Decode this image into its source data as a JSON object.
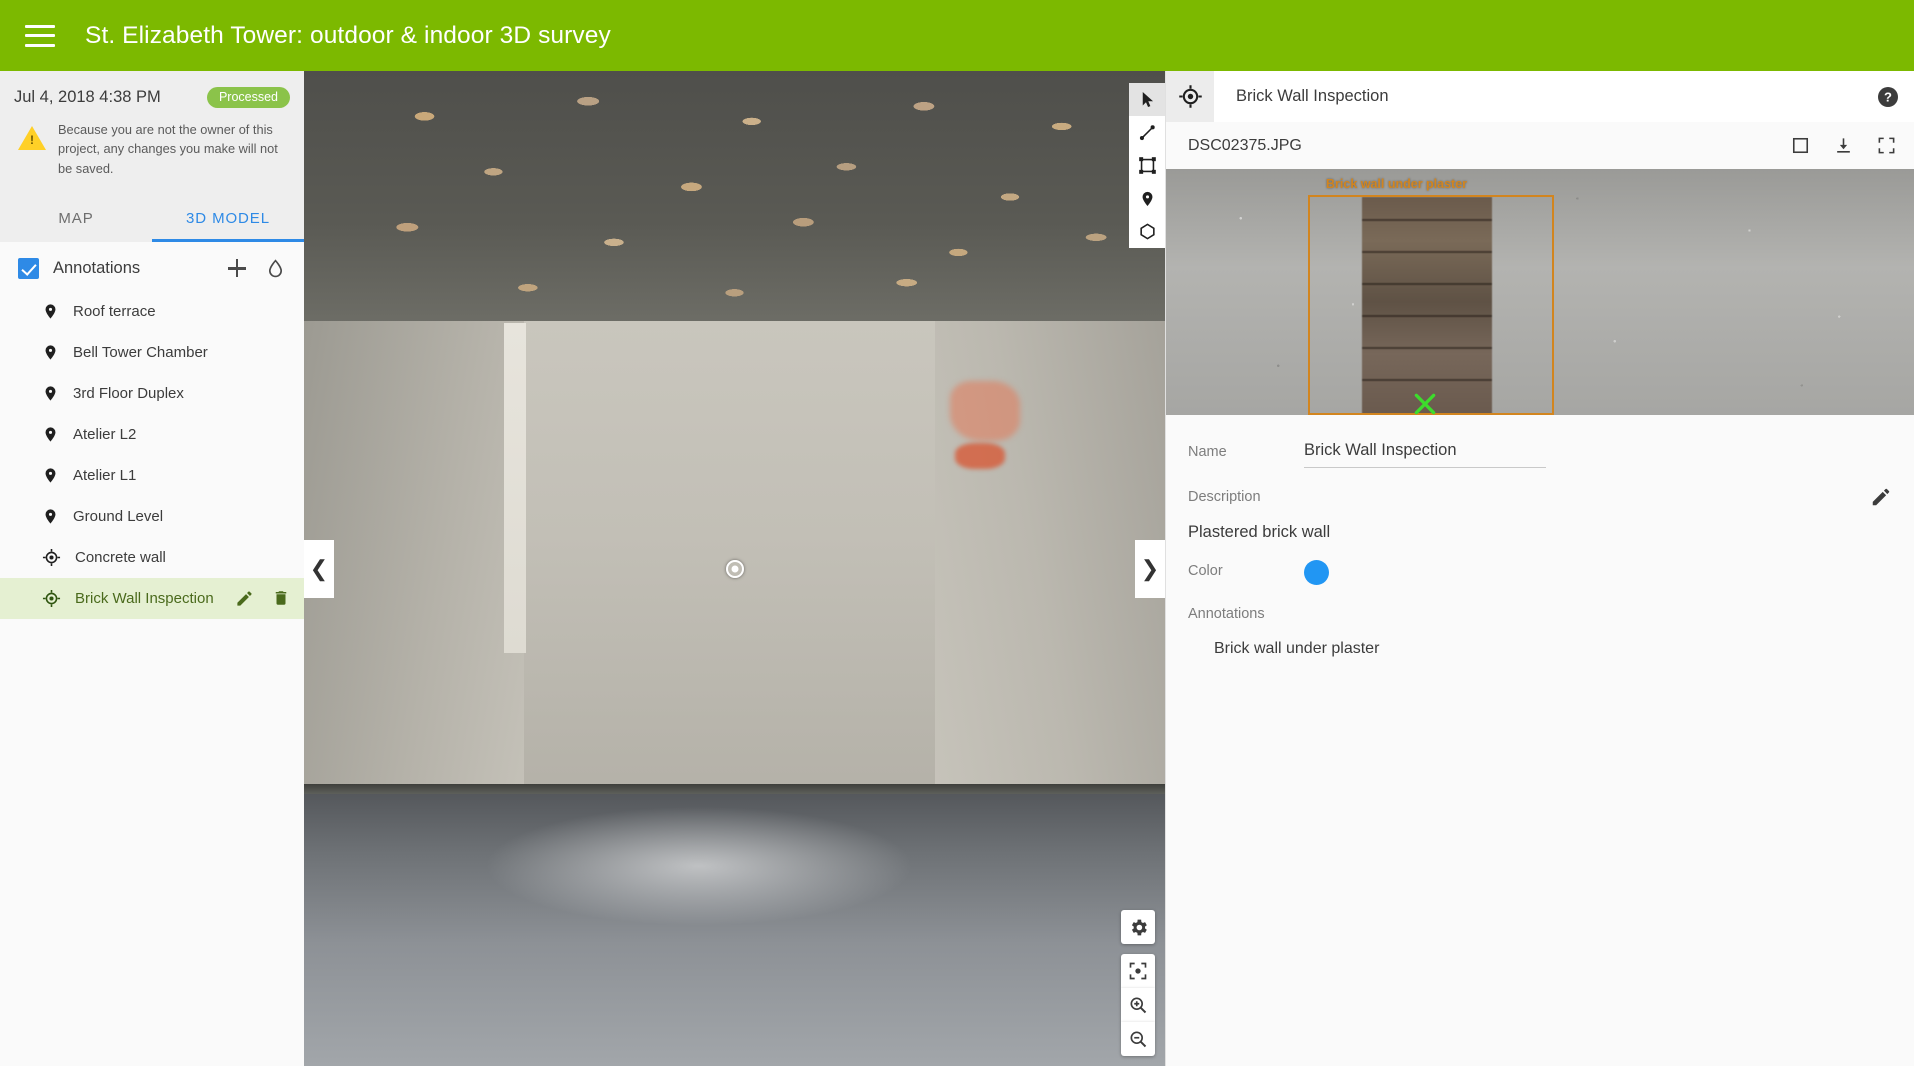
{
  "header": {
    "menu_icon": "hamburger-menu-icon",
    "title": "St. Elizabeth Tower: outdoor & indoor 3D survey",
    "background_color": "#7cb900"
  },
  "sidebar": {
    "date": "Jul 4, 2018 4:38 PM",
    "status_badge": "Processed",
    "status_color": "#8bc34a",
    "warning_icon": "warning-triangle-icon",
    "warning_text": "Because you are not the owner of this project, any changes you make will not be saved.",
    "tabs": [
      {
        "label": "MAP",
        "active": false
      },
      {
        "label": "3D MODEL",
        "active": true
      }
    ],
    "active_tab_color": "#2e8ae6",
    "annotations_group": {
      "label": "Annotations",
      "checked": true,
      "add_icon": "plus-icon",
      "layer_icon": "droplet-icon"
    },
    "items": [
      {
        "label": "Roof terrace",
        "icon": "map-pin-icon",
        "selected": false
      },
      {
        "label": "Bell Tower Chamber",
        "icon": "map-pin-icon",
        "selected": false
      },
      {
        "label": "3rd Floor Duplex",
        "icon": "map-pin-icon",
        "selected": false
      },
      {
        "label": "Atelier L2",
        "icon": "map-pin-icon",
        "selected": false
      },
      {
        "label": "Atelier L1",
        "icon": "map-pin-icon",
        "selected": false
      },
      {
        "label": "Ground Level",
        "icon": "map-pin-icon",
        "selected": false
      },
      {
        "label": "Concrete wall",
        "icon": "target-crosshair-icon",
        "selected": false
      },
      {
        "label": "Brick Wall Inspection",
        "icon": "target-crosshair-icon",
        "selected": true,
        "edit_icon": "pencil-icon",
        "delete_icon": "trash-icon"
      }
    ],
    "selected_row_color": "#e5f0d2"
  },
  "viewer": {
    "nav_prev_icon": "chevron-left-icon",
    "nav_next_icon": "chevron-right-icon",
    "reticle_icon": "center-reticle-icon",
    "tools": [
      {
        "name": "cursor-tool",
        "icon": "arrow-cursor-icon",
        "active": true
      },
      {
        "name": "distance-tool",
        "icon": "line-segment-icon",
        "active": false
      },
      {
        "name": "area-tool",
        "icon": "bounding-box-icon",
        "active": false
      },
      {
        "name": "marker-tool",
        "icon": "map-pin-icon",
        "active": false
      },
      {
        "name": "polygon-tool",
        "icon": "hexagon-icon",
        "active": false
      }
    ],
    "controls": [
      {
        "name": "settings-button",
        "icon": "gear-icon"
      },
      {
        "name": "center-view-button",
        "icon": "center-focus-icon"
      },
      {
        "name": "zoom-in-button",
        "icon": "magnifier-plus-icon"
      },
      {
        "name": "zoom-out-button",
        "icon": "magnifier-minus-icon"
      }
    ]
  },
  "right_panel": {
    "target_icon": "target-crosshair-icon",
    "title": "Brick Wall Inspection",
    "help_icon": "help-circle-icon",
    "filename": "DSC02375.JPG",
    "file_actions": [
      {
        "name": "toggle-box-button",
        "icon": "square-outline-icon"
      },
      {
        "name": "download-button",
        "icon": "download-icon"
      },
      {
        "name": "fullscreen-button",
        "icon": "fullscreen-icon"
      }
    ],
    "photo": {
      "annotation_label": "Brick wall under plaster",
      "annotation_box_color": "#d2851f",
      "marker_icon": "green-x-marker-icon",
      "marker_color": "#3ddd2c"
    },
    "fields": {
      "name_label": "Name",
      "name_value": "Brick Wall Inspection",
      "description_label": "Description",
      "description_value": "Plastered brick wall",
      "description_edit_icon": "pencil-icon",
      "color_label": "Color",
      "color_value": "#2196f3",
      "annotations_label": "Annotations",
      "annotations_items": [
        "Brick wall under plaster"
      ]
    }
  }
}
